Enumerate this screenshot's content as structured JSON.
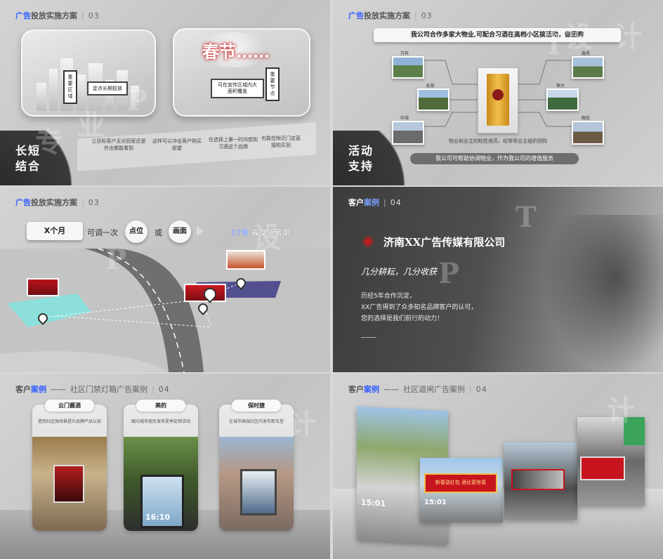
{
  "headers": {
    "plan_accent": "广告",
    "plan_title": "投放实施方案",
    "plan_num": "03",
    "case_accent": "客户案例",
    "case_accent_a": "客户",
    "case_accent_b": "案例",
    "case_num": "04",
    "case_sub_1": "社区门禁灯箱广告案例",
    "case_sub_2": "社区道闸广告案例"
  },
  "slide1": {
    "tag_left_v": "重要区域",
    "tag_left_h": "定点长期投放",
    "spring_text": "春节……",
    "tag_right_h": "可在宣传区域内大面积覆盖",
    "tag_right_v": "重要节点",
    "notes": [
      "让目标客户无论回家还是外出都能看到",
      "这样可以冲击客户购买欲望",
      "在选择上第一时间想到习酒这个品牌",
      "也能在附近门店直接购买到"
    ],
    "corner": [
      "长短",
      "结合"
    ]
  },
  "slide2": {
    "banner": "我公司合作多家大物业,可配合习酒在高档小区搞活动，做团购",
    "left_labels": [
      "万科",
      "龙湖",
      "中海"
    ],
    "right_labels": [
      "鑫苑",
      "恒大",
      "融信"
    ],
    "mid_note": "物业和业主的粘性很高，经常帮业主组织团购",
    "bottom_pill": "我公司可帮助协调物业，作为我公司的增值服务",
    "corner": [
      "活动",
      "支持"
    ]
  },
  "slide3": {
    "box1": "X个月",
    "text1": "可调一次",
    "circle1": "点位",
    "text2": "或",
    "circle2": "画面",
    "fatigue_tag": "1T审",
    "fatigue_text": "视觉疲劳期"
  },
  "slide4": {
    "company": "济南XX广告传媒有限公司",
    "motto": "几分耕耘，几分收获",
    "lines": [
      "历经5年合作沉淀，",
      "XX广告得到了众多知名品牌客户的认可，",
      "您的选择是我们前行的动力！"
    ]
  },
  "slide5": {
    "cards": [
      {
        "title": "云门酱酒",
        "desc": "借用社区微场景提升品牌产品认知"
      },
      {
        "title": "美的",
        "desc": "面向城市居民发布夏季促销活动"
      },
      {
        "title": "保时捷",
        "desc": "在城市高端社区内发布新车型"
      }
    ],
    "screen_time": "16:10"
  },
  "slide6": {
    "time_left": "15:01",
    "time_mid": "15:01",
    "banner_text": "新春送红包 酒业更惊喜"
  },
  "watermark": [
    "专",
    "业",
    "P",
    "P",
    "T",
    "设",
    "计"
  ],
  "colors": {
    "accent": "#2f5cff",
    "dark": "#333333",
    "red": "#c8141e"
  }
}
